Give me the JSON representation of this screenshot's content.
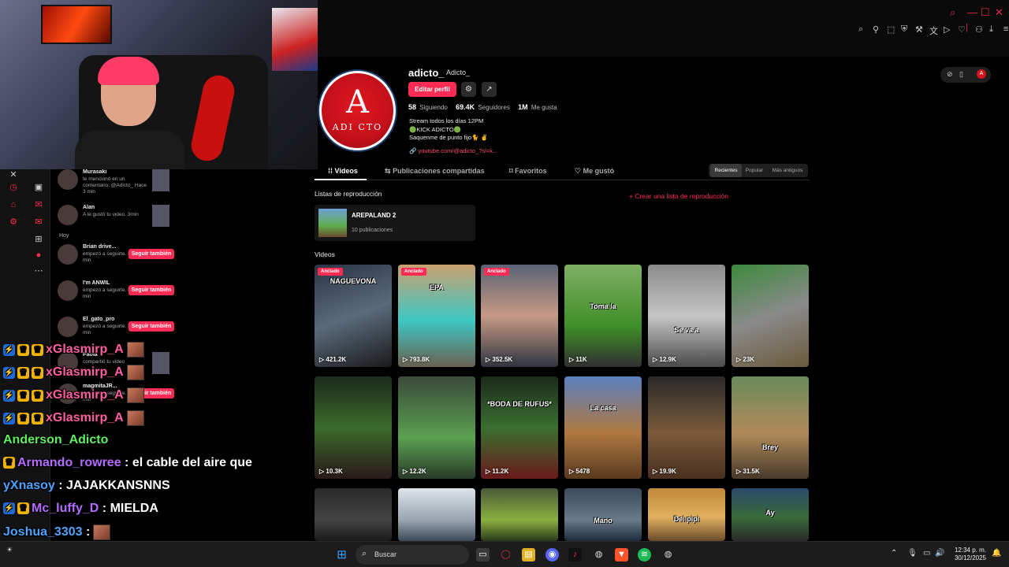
{
  "profile": {
    "username": "adicto_",
    "nickname": "Adicto_",
    "edit_label": "Editar perfil",
    "avatar_letter": "A",
    "avatar_text": "ADI CTO",
    "following_count": "58",
    "following_label": "Siguiendo",
    "followers_count": "69.4K",
    "followers_label": "Seguidores",
    "likes_count": "1M",
    "likes_label": "Me gusta",
    "bio_line1": "Stream todos los días 12PM",
    "bio_line2": "🟢KICK ADICTO🟢",
    "bio_line3": "Saquenme de punto fijo🐈 ✌",
    "bio_link": "youtube.com/@adicto_?si=k..."
  },
  "tabs": [
    {
      "label": "Videos"
    },
    {
      "label": "Publicaciones compartidas"
    },
    {
      "label": "Favoritos"
    },
    {
      "label": "Me gustó"
    }
  ],
  "sort": {
    "recent": "Recientes",
    "popular": "Popular",
    "oldest": "Más antiguos"
  },
  "playlists": {
    "section_label": "Listas de reproducción",
    "create_label": "+ Crear una lista de reproducción",
    "items": [
      {
        "title": "AREPALAND 2",
        "count": "10 publicaciones"
      }
    ]
  },
  "videos_label": "Videos",
  "pinned_label": "Anclado",
  "videos": [
    {
      "views": "421.2K",
      "caption": "NAGUEVONA"
    },
    {
      "views": "793.8K",
      "caption": "EPA"
    },
    {
      "views": "352.5K",
      "caption": ""
    },
    {
      "views": "11K",
      "caption": "Toma la"
    },
    {
      "views": "12.9K",
      "caption": "Se va a"
    },
    {
      "views": "23K",
      "caption": ""
    },
    {
      "views": "10.3K",
      "caption": ""
    },
    {
      "views": "12.2K",
      "caption": ""
    },
    {
      "views": "11.2K",
      "caption": "*BODA DE RUFUS*"
    },
    {
      "views": "5478",
      "caption": "La casa"
    },
    {
      "views": "19.9K",
      "caption": ""
    },
    {
      "views": "31.5K",
      "caption": "Brey"
    },
    {
      "views": "",
      "caption": ""
    },
    {
      "views": "",
      "caption": ""
    },
    {
      "views": "",
      "caption": ""
    },
    {
      "views": "",
      "caption": "Mano"
    },
    {
      "views": "",
      "caption": "Del pipi"
    },
    {
      "views": "",
      "caption": "Ay"
    }
  ],
  "notifications": [
    {
      "name": "Murasaki",
      "text": "te mencionó en un comentario: @Adicto_ Hace 3 min"
    },
    {
      "name": "Alan",
      "text": "A le gustó tu video. 3min"
    },
    {
      "name": "Brian drive...",
      "text": "empezó a seguirte. Hace 11 min",
      "action": "Seguir también"
    },
    {
      "name": "I'm ANWIL",
      "text": "empezó a seguirte. Hace 12 min",
      "action": "Seguir también"
    },
    {
      "name": "El_gato_pro",
      "text": "empezó a seguirte. Hace 22 min",
      "action": "Seguir también"
    },
    {
      "name": "Paola",
      "text": "compartió tu video"
    },
    {
      "name": "magmitaJR...",
      "text": "empezó a seguirte. Hace 41 min",
      "action": "Seguir también"
    }
  ],
  "notif_day_label": "Hoy",
  "chat": [
    {
      "user": "xGlasmirp_A",
      "message": "",
      "color": "#ff5ea0"
    },
    {
      "user": "xGlasmirp_A",
      "message": "",
      "color": "#ff5ea0"
    },
    {
      "user": "xGlasmirp_A",
      "message": "",
      "color": "#ff5ea0"
    },
    {
      "user": "xGlasmirp_A",
      "message": "",
      "color": "#ff5ea0"
    },
    {
      "user": "Anderson_Adicto",
      "message": "",
      "color": "#5ef05e"
    },
    {
      "user": "Armando_rowree",
      "message": ": el cable del aire que",
      "color": "#b46cff"
    },
    {
      "user": "yXnasoy",
      "message": ": JAJAKKANSNNS",
      "color": "#4fa3ff"
    },
    {
      "user": "Mc_luffy_D",
      "message": ": MIELDA",
      "color": "#b46cff"
    },
    {
      "user": "Joshua_3303",
      "message": ":",
      "color": "#4fa3ff"
    },
    {
      "user": "Anderson_Adicto",
      "message": ":",
      "color": "#5ef05e"
    }
  ],
  "taskbar": {
    "search_placeholder": "Buscar",
    "time": "12:34 p. m.",
    "date": "30/12/2025"
  },
  "colors": {
    "accent": "#fe2c55",
    "background": "#000000"
  }
}
